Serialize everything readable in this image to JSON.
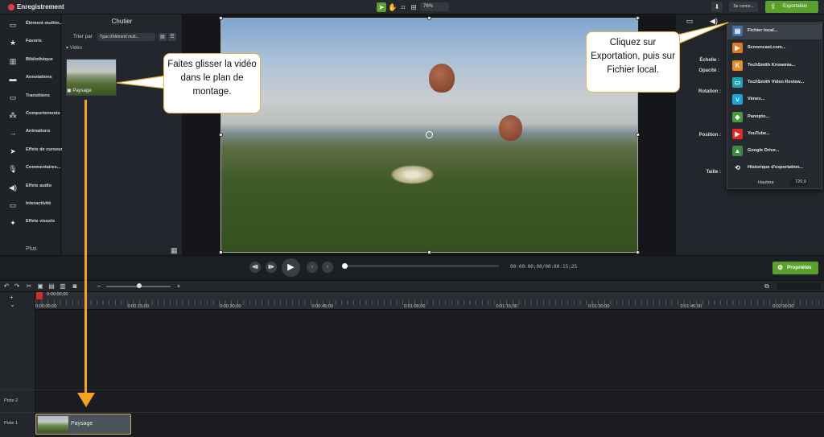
{
  "app": {
    "title": "Enregistrement",
    "zoom": "76%",
    "signin": "Se conne...",
    "export_label": "Exportation"
  },
  "sidebar": {
    "items": [
      {
        "label": "Élément multim...",
        "icon": "media-icon"
      },
      {
        "label": "Favoris",
        "icon": "star-icon"
      },
      {
        "label": "Bibliothèque",
        "icon": "library-icon"
      },
      {
        "label": "Annotations",
        "icon": "annotation-icon"
      },
      {
        "label": "Transitions",
        "icon": "transition-icon"
      },
      {
        "label": "Comportements",
        "icon": "behavior-icon"
      },
      {
        "label": "Animations",
        "icon": "animation-icon"
      },
      {
        "label": "Effets de curseur",
        "icon": "cursor-icon"
      },
      {
        "label": "Commentaires...",
        "icon": "mic-icon"
      },
      {
        "label": "Effets audio",
        "icon": "audio-icon"
      },
      {
        "label": "Interactivité",
        "icon": "interactive-icon"
      },
      {
        "label": "Effets visuels",
        "icon": "wand-icon"
      }
    ],
    "more": "Plus"
  },
  "bin": {
    "title": "Chutier",
    "sort_label": "Trier par",
    "sort_value": "Type d'élément mult...",
    "section": "Vidéo",
    "clip_name": "Paysage"
  },
  "properties": {
    "labels": {
      "scale": "Échelle :",
      "opacity": "Opacité :",
      "rotation": "Rotation :",
      "position": "Position :",
      "size": "Taille :"
    }
  },
  "export_menu": {
    "items": [
      {
        "label": "Fichier local...",
        "color": "#3d6fa8",
        "glyph": "▤"
      },
      {
        "label": "Screencast.com...",
        "color": "#e07a1f",
        "glyph": "▶"
      },
      {
        "label": "TechSmith Knowmia...",
        "color": "#e88a2a",
        "glyph": "K"
      },
      {
        "label": "TechSmith Video Review...",
        "color": "#1ea3b5",
        "glyph": "▭"
      },
      {
        "label": "Vimeo...",
        "color": "#1aa7d8",
        "glyph": "v"
      },
      {
        "label": "Panopto...",
        "color": "#4a9a3a",
        "glyph": "◆"
      },
      {
        "label": "YouTube...",
        "color": "#e02a2a",
        "glyph": "▶"
      },
      {
        "label": "Google Drive...",
        "color": "#3b8a3e",
        "glyph": "▲"
      },
      {
        "label": "Historique d'exportation...",
        "color": "transparent",
        "glyph": "⟲"
      }
    ],
    "height_label": "Hauteur",
    "height_value": "720,0"
  },
  "transport": {
    "timecode": "00:00:00;00/00:00:15;25",
    "properties_button": "Propriétés"
  },
  "timeline": {
    "playhead": "0:00:00;00",
    "ticks": [
      "0:00:00;00",
      "0:00:15;00",
      "0:00:30;00",
      "0:00:45;00",
      "0:01:00;00",
      "0:01:15;00",
      "0:01:30;00",
      "0:01:45;00",
      "0:02:00;00"
    ],
    "tracks": [
      "Piste 2",
      "Piste 1"
    ],
    "clip_label": "Paysage"
  },
  "callouts": {
    "drag": "Faites glisser la vidéo dans le plan de montage.",
    "export": "Cliquez sur Exportation, puis sur Fichier local."
  },
  "colors": {
    "accent": "#5aa02c",
    "callout_border": "#e4b84a",
    "arrow": "#f3a321"
  }
}
